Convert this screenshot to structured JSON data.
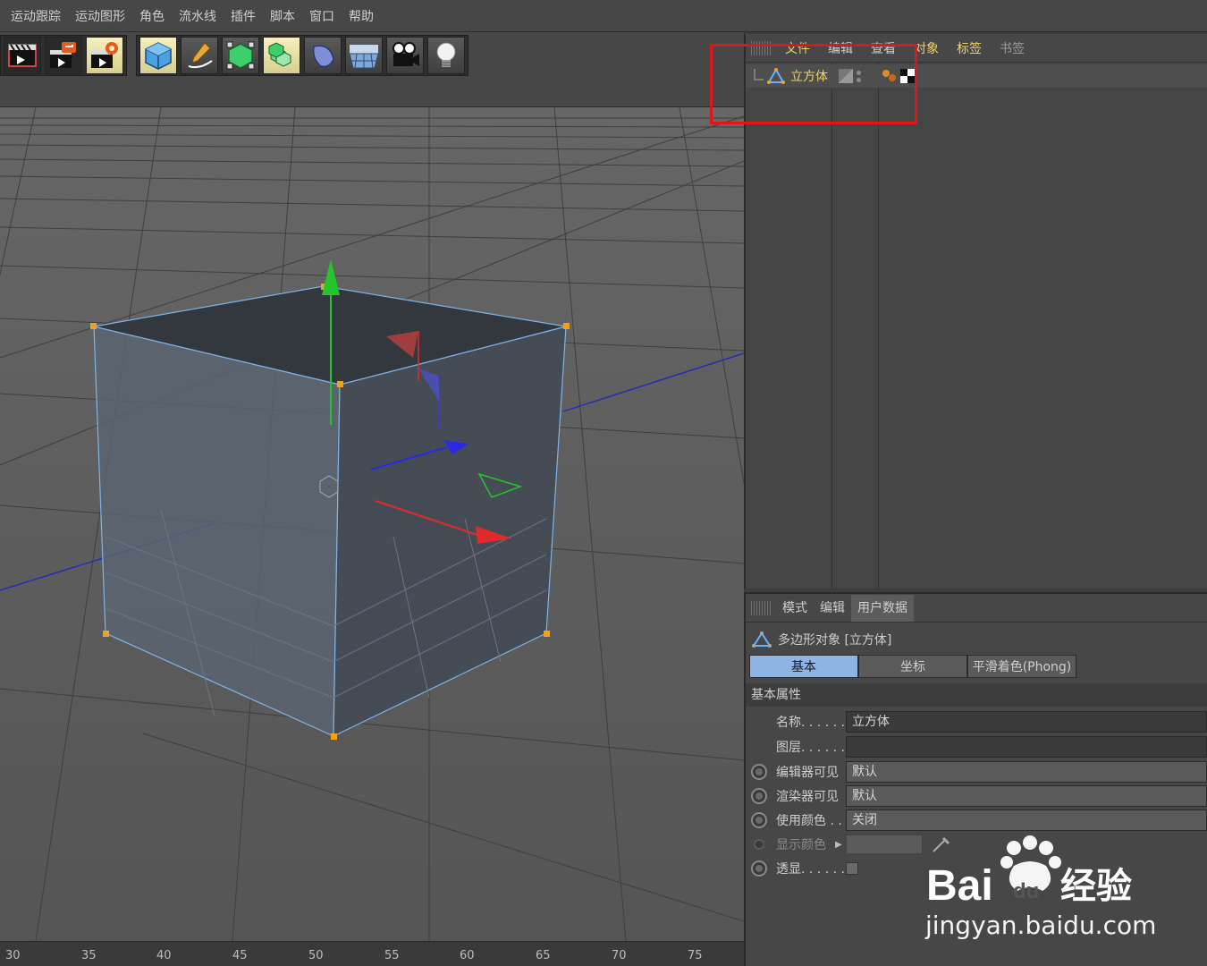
{
  "menubar": {
    "items": [
      {
        "label": "运动跟踪",
        "hl": true
      },
      {
        "label": "运动图形",
        "hl": false
      },
      {
        "label": "角色",
        "hl": false
      },
      {
        "label": "流水线",
        "hl": false
      },
      {
        "label": "插件",
        "hl": false
      },
      {
        "label": "脚本",
        "hl": true
      },
      {
        "label": "窗口",
        "hl": true
      },
      {
        "label": "帮助",
        "hl": false
      }
    ]
  },
  "toolbar": {
    "group1": [
      "render-view-icon",
      "render-picture-icon",
      "render-settings-icon"
    ],
    "group2": [
      "cube-icon",
      "pen-icon",
      "subdivision-icon",
      "array-icon",
      "deformer-icon",
      "floor-icon",
      "camera-icon",
      "light-icon"
    ]
  },
  "ruler": {
    "ticks": [
      "30",
      "35",
      "40",
      "45",
      "50",
      "55",
      "60",
      "65",
      "70",
      "75"
    ]
  },
  "object_manager": {
    "menu": [
      {
        "label": "文件",
        "cls": "hl"
      },
      {
        "label": "编辑",
        "cls": ""
      },
      {
        "label": "查看",
        "cls": ""
      },
      {
        "label": "对象",
        "cls": "hl"
      },
      {
        "label": "标签",
        "cls": "hl"
      },
      {
        "label": "书签",
        "cls": "dim"
      }
    ],
    "object_name": "立方体"
  },
  "attribute_manager": {
    "menu": [
      {
        "label": "模式",
        "active": false
      },
      {
        "label": "编辑",
        "active": false
      },
      {
        "label": "用户数据",
        "active": true
      }
    ],
    "title": "多边形对象 [立方体]",
    "tabs": [
      {
        "label": "基本",
        "active": true
      },
      {
        "label": "坐标",
        "active": false
      },
      {
        "label": "平滑着色(Phong)",
        "active": false
      }
    ],
    "section": "基本属性",
    "props": {
      "name_label": "名称. . . . . .",
      "name_value": "立方体",
      "layer_label": "图层. . . . . .",
      "layer_value": "",
      "editor_vis_label": "编辑器可见",
      "editor_vis_value": "默认",
      "render_vis_label": "渲染器可见",
      "render_vis_value": "默认",
      "use_color_label": "使用颜色 . .",
      "use_color_value": "关闭",
      "display_color_label": "显示颜色",
      "xray_label": "透显. . . . . ."
    }
  },
  "watermark": {
    "brand": "Bai",
    "brand2": "du",
    "cn": "经验",
    "url": "jingyan.baidu.com"
  },
  "colors": {
    "accent_yellow": "#f0d070",
    "highlight_red": "#e0161b",
    "active_tab_blue": "#8fb4e4"
  }
}
